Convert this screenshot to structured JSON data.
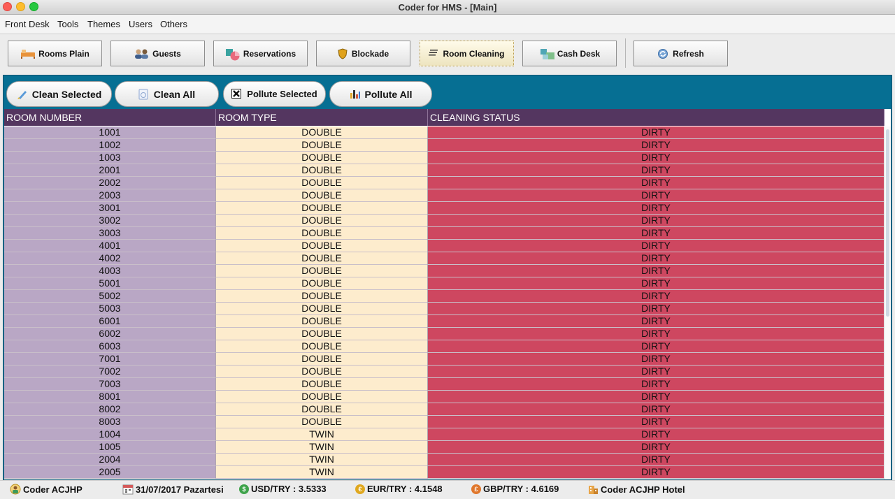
{
  "window": {
    "title": "Coder for HMS - [Main]"
  },
  "menu": [
    "Front Desk",
    "Tools",
    "Themes",
    "Users",
    "Others"
  ],
  "toolbar": {
    "rooms_plain": "Rooms Plain",
    "guests": "Guests",
    "reservations": "Reservations",
    "blockade": "Blockade",
    "room_cleaning": "Room Cleaning",
    "cash_desk": "Cash Desk",
    "refresh": "Refresh"
  },
  "actions": {
    "clean_selected": "Clean Selected",
    "clean_all": "Clean All",
    "pollute_selected": "Pollute Selected",
    "pollute_all": "Pollute All"
  },
  "table": {
    "headers": [
      "ROOM NUMBER",
      "ROOM TYPE",
      "CLEANING STATUS"
    ],
    "rows": [
      [
        "1001",
        "DOUBLE",
        "DIRTY"
      ],
      [
        "1002",
        "DOUBLE",
        "DIRTY"
      ],
      [
        "1003",
        "DOUBLE",
        "DIRTY"
      ],
      [
        "2001",
        "DOUBLE",
        "DIRTY"
      ],
      [
        "2002",
        "DOUBLE",
        "DIRTY"
      ],
      [
        "2003",
        "DOUBLE",
        "DIRTY"
      ],
      [
        "3001",
        "DOUBLE",
        "DIRTY"
      ],
      [
        "3002",
        "DOUBLE",
        "DIRTY"
      ],
      [
        "3003",
        "DOUBLE",
        "DIRTY"
      ],
      [
        "4001",
        "DOUBLE",
        "DIRTY"
      ],
      [
        "4002",
        "DOUBLE",
        "DIRTY"
      ],
      [
        "4003",
        "DOUBLE",
        "DIRTY"
      ],
      [
        "5001",
        "DOUBLE",
        "DIRTY"
      ],
      [
        "5002",
        "DOUBLE",
        "DIRTY"
      ],
      [
        "5003",
        "DOUBLE",
        "DIRTY"
      ],
      [
        "6001",
        "DOUBLE",
        "DIRTY"
      ],
      [
        "6002",
        "DOUBLE",
        "DIRTY"
      ],
      [
        "6003",
        "DOUBLE",
        "DIRTY"
      ],
      [
        "7001",
        "DOUBLE",
        "DIRTY"
      ],
      [
        "7002",
        "DOUBLE",
        "DIRTY"
      ],
      [
        "7003",
        "DOUBLE",
        "DIRTY"
      ],
      [
        "8001",
        "DOUBLE",
        "DIRTY"
      ],
      [
        "8002",
        "DOUBLE",
        "DIRTY"
      ],
      [
        "8003",
        "DOUBLE",
        "DIRTY"
      ],
      [
        "1004",
        "TWIN",
        "DIRTY"
      ],
      [
        "1005",
        "TWIN",
        "DIRTY"
      ],
      [
        "2004",
        "TWIN",
        "DIRTY"
      ],
      [
        "2005",
        "TWIN",
        "DIRTY"
      ]
    ]
  },
  "status": {
    "user": "Coder ACJHP",
    "date": "31/07/2017 Pazartesi",
    "usd": "USD/TRY : 3.5333",
    "eur": "EUR/TRY : 4.1548",
    "gbp": "GBP/TRY : 4.6169",
    "hotel": "Coder ACJHP Hotel"
  },
  "colors": {
    "panel": "#066f93",
    "header": "#543660",
    "room_number_cell": "#b9a7c5",
    "room_type_cell": "#fdeccd",
    "status_dirty_cell": "#ce4760"
  },
  "icons": {
    "usd_coin": "$",
    "eur_coin": "€",
    "gbp_coin": "£"
  }
}
